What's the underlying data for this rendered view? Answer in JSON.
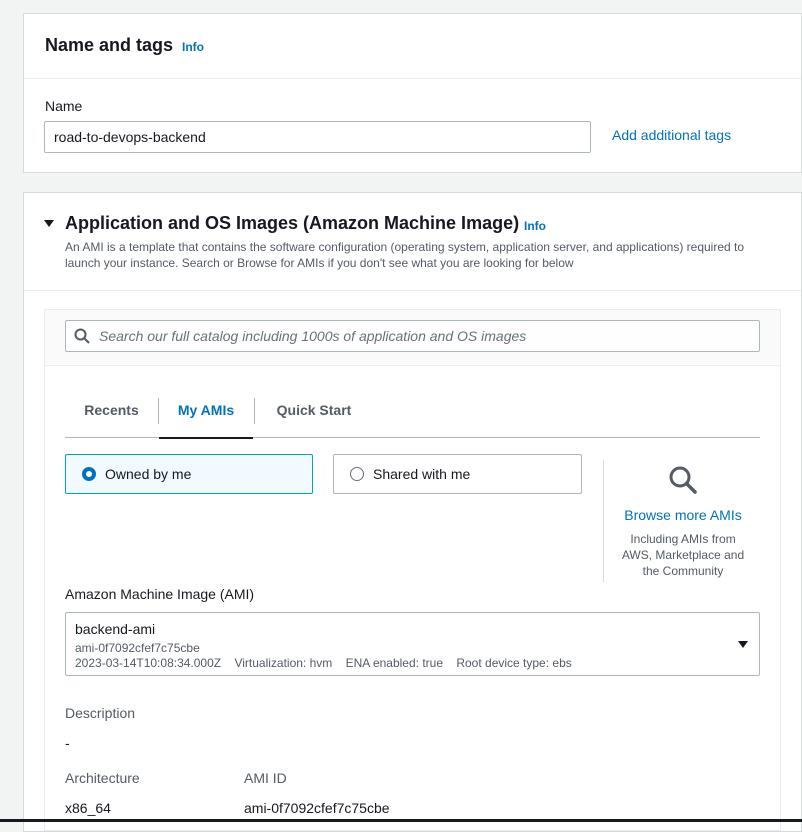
{
  "name_tags": {
    "title": "Name and tags",
    "info": "Info",
    "name_label": "Name",
    "name_value": "road-to-devops-backend",
    "add_tags": "Add additional tags"
  },
  "ami_section": {
    "title": "Application and OS Images (Amazon Machine Image)",
    "info": "Info",
    "desc_line1": "An AMI is a template that contains the software configuration (operating system, application server, and applications) required to",
    "desc_line2": "launch your instance. Search or Browse for AMIs if you don't see what you are looking for below",
    "search_placeholder": "Search our full catalog including 1000s of application and OS images",
    "tabs": [
      "Recents",
      "My AMIs",
      "Quick Start"
    ],
    "active_tab": "My AMIs",
    "owner_options": [
      "Owned by me",
      "Shared with me"
    ],
    "selected_owner": "Owned by me",
    "browse_more": "Browse more AMIs",
    "browse_note_1": "Including AMIs from",
    "browse_note_2": "AWS, Marketplace and",
    "browse_note_3": "the Community",
    "ami_label": "Amazon Machine Image (AMI)",
    "ami_name": "backend-ami",
    "ami_id": "ami-0f7092cfef7c75cbe",
    "ami_meta": "2023-03-14T10:08:34.000Z    Virtualization: hvm    ENA enabled: true    Root device type: ebs",
    "description_label": "Description",
    "description_value": "-",
    "architecture_label": "Architecture",
    "architecture_value": "x86_64",
    "amiid_label": "AMI ID",
    "amiid_value": "ami-0f7092cfef7c75cbe"
  },
  "colors": {
    "link": "#0073bb",
    "selected_card_bg": "#f1faff",
    "selected_card_border": "#00a1c9"
  }
}
